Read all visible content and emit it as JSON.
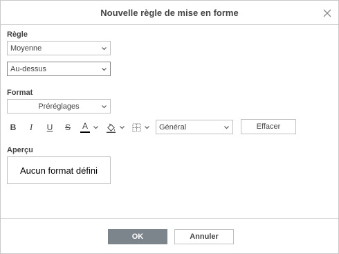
{
  "dialog": {
    "title": "Nouvelle règle de mise en forme"
  },
  "rule": {
    "label": "Règle",
    "type_value": "Moyenne",
    "condition_value": "Au-dessus"
  },
  "format": {
    "label": "Format",
    "presets_value": "Préréglages",
    "number_format_value": "Général",
    "clear_label": "Effacer",
    "colors": {
      "font_color_bar": "#000000"
    }
  },
  "toolbar": {
    "bold_glyph": "B",
    "italic_glyph": "I",
    "underline_glyph": "U",
    "strike_glyph": "S",
    "font_color_glyph": "A"
  },
  "preview": {
    "label": "Aperçu",
    "text": "Aucun format défini"
  },
  "footer": {
    "ok_label": "OK",
    "cancel_label": "Annuler",
    "colors": {
      "ok_bg": "#7d858c"
    }
  }
}
